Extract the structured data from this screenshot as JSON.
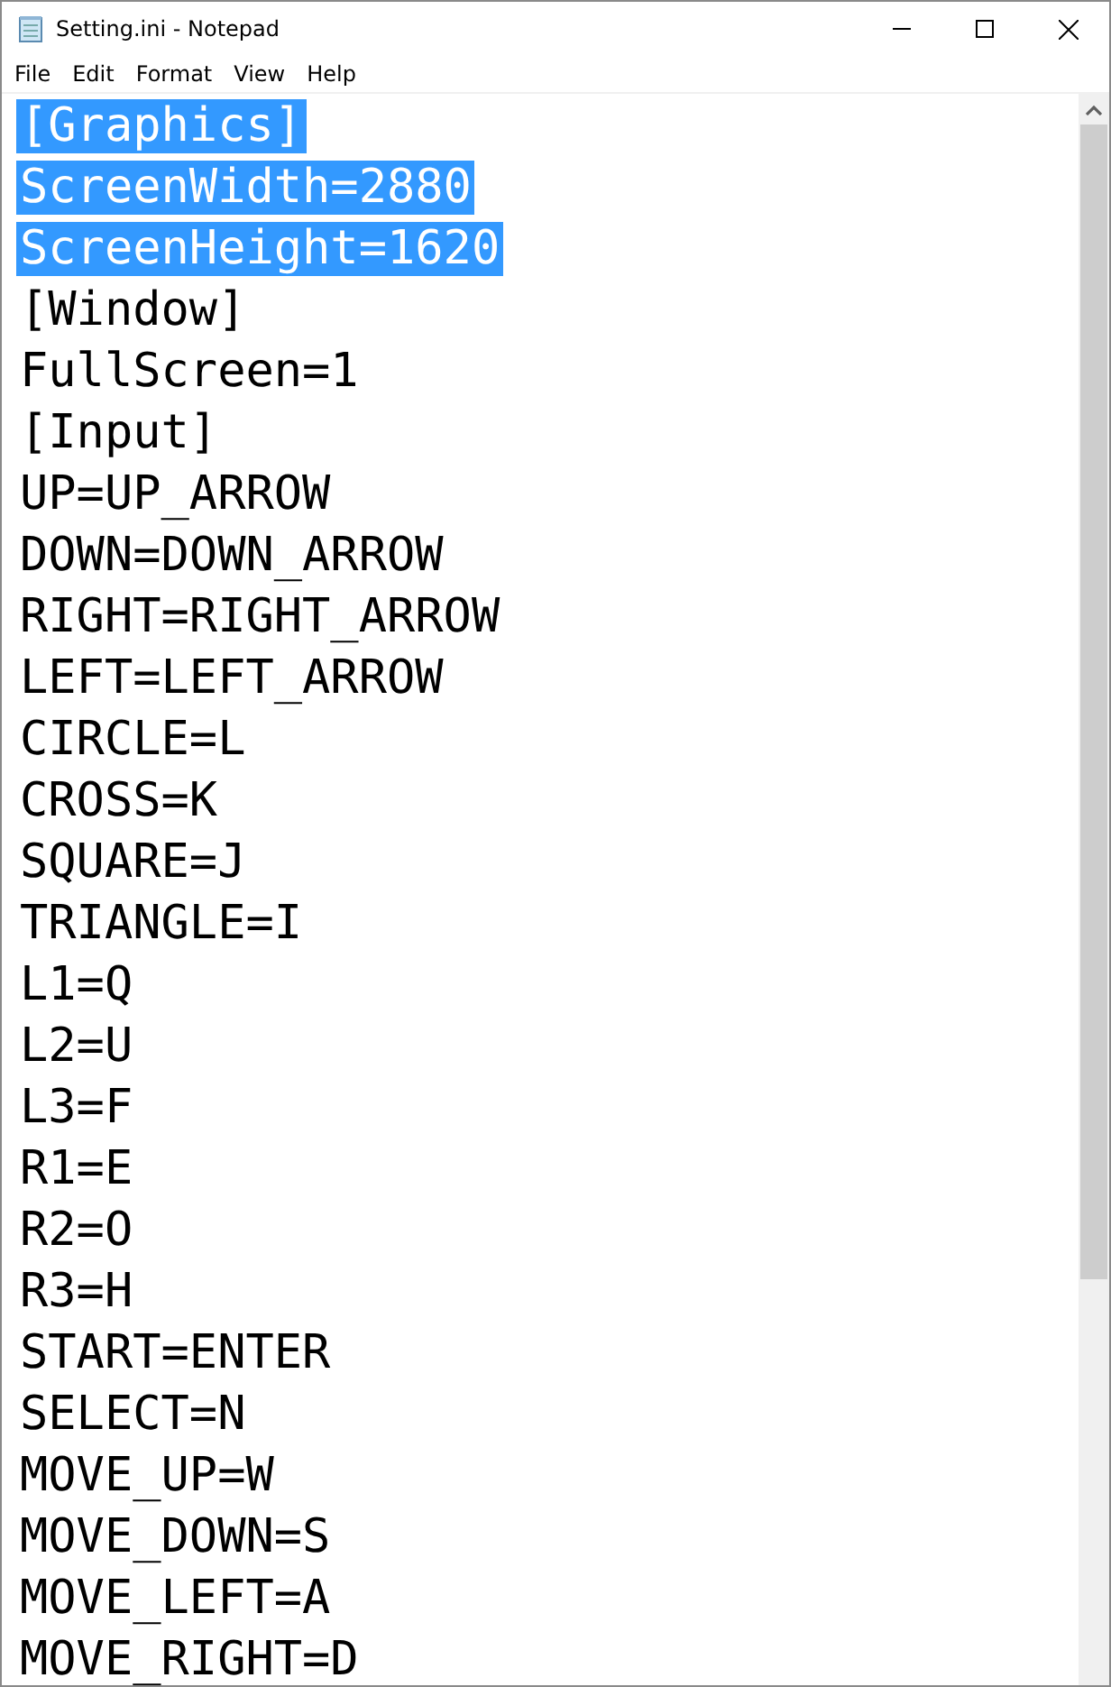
{
  "window": {
    "title": "Setting.ini - Notepad"
  },
  "menu": [
    "File",
    "Edit",
    "Format",
    "View",
    "Help"
  ],
  "lines": [
    {
      "text": "[Graphics]",
      "selected": true
    },
    {
      "text": "ScreenWidth=2880",
      "selected": true
    },
    {
      "text": "ScreenHeight=1620",
      "selected": true
    },
    {
      "text": "[Window]",
      "selected": false
    },
    {
      "text": "FullScreen=1",
      "selected": false
    },
    {
      "text": "[Input]",
      "selected": false
    },
    {
      "text": "UP=UP_ARROW",
      "selected": false
    },
    {
      "text": "DOWN=DOWN_ARROW",
      "selected": false
    },
    {
      "text": "RIGHT=RIGHT_ARROW",
      "selected": false
    },
    {
      "text": "LEFT=LEFT_ARROW",
      "selected": false
    },
    {
      "text": "CIRCLE=L",
      "selected": false
    },
    {
      "text": "CROSS=K",
      "selected": false
    },
    {
      "text": "SQUARE=J",
      "selected": false
    },
    {
      "text": "TRIANGLE=I",
      "selected": false
    },
    {
      "text": "L1=Q",
      "selected": false
    },
    {
      "text": "L2=U",
      "selected": false
    },
    {
      "text": "L3=F",
      "selected": false
    },
    {
      "text": "R1=E",
      "selected": false
    },
    {
      "text": "R2=O",
      "selected": false
    },
    {
      "text": "R3=H",
      "selected": false
    },
    {
      "text": "START=ENTER",
      "selected": false
    },
    {
      "text": "SELECT=N",
      "selected": false
    },
    {
      "text": "MOVE_UP=W",
      "selected": false
    },
    {
      "text": "MOVE_DOWN=S",
      "selected": false
    },
    {
      "text": "MOVE_LEFT=A",
      "selected": false
    },
    {
      "text": "MOVE_RIGHT=D",
      "selected": false
    }
  ]
}
